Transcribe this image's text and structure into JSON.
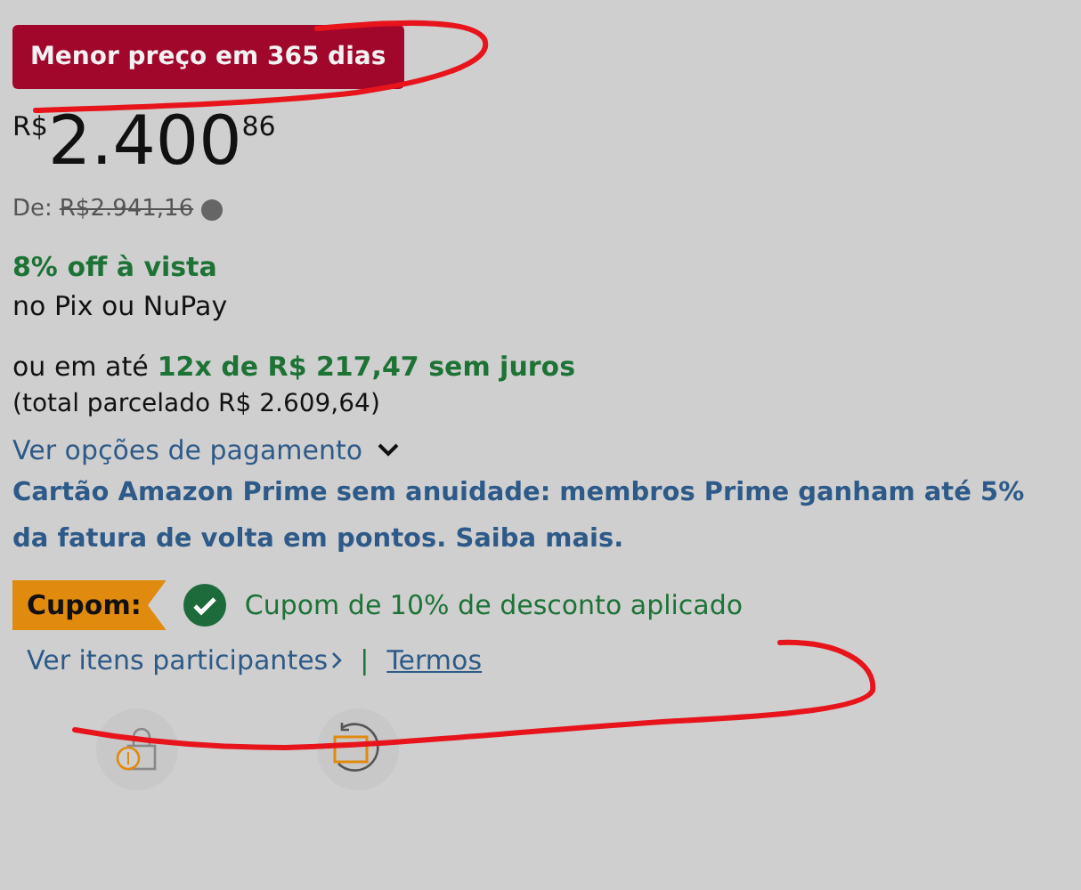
{
  "badge": "Menor preço em 365 dias",
  "price": {
    "currency": "R$",
    "whole": "2.400",
    "fraction": "86"
  },
  "list_price": {
    "label": "De:",
    "value": "R$2.941,16"
  },
  "discount": {
    "headline": "8% off à vista",
    "detail": "no Pix ou NuPay"
  },
  "installments": {
    "prefix": "ou em até",
    "highlight": "12x de R$ 217,47 sem juros",
    "total": "(total parcelado R$ 2.609,64)"
  },
  "payment_options_link": "Ver opções de pagamento",
  "promo_link": "Cartão Amazon Prime sem anuidade: membros Prime ganham até 5% da fatura de volta em pontos. Saiba mais.",
  "coupon": {
    "label": "Cupom:",
    "applied": true,
    "message": "Cupom de 10% de desconto aplicado",
    "items_link": "Ver itens participantes",
    "separator": "|",
    "terms_link": "Termos"
  },
  "features": [
    {
      "kind": "secure"
    },
    {
      "kind": "returns"
    }
  ]
}
